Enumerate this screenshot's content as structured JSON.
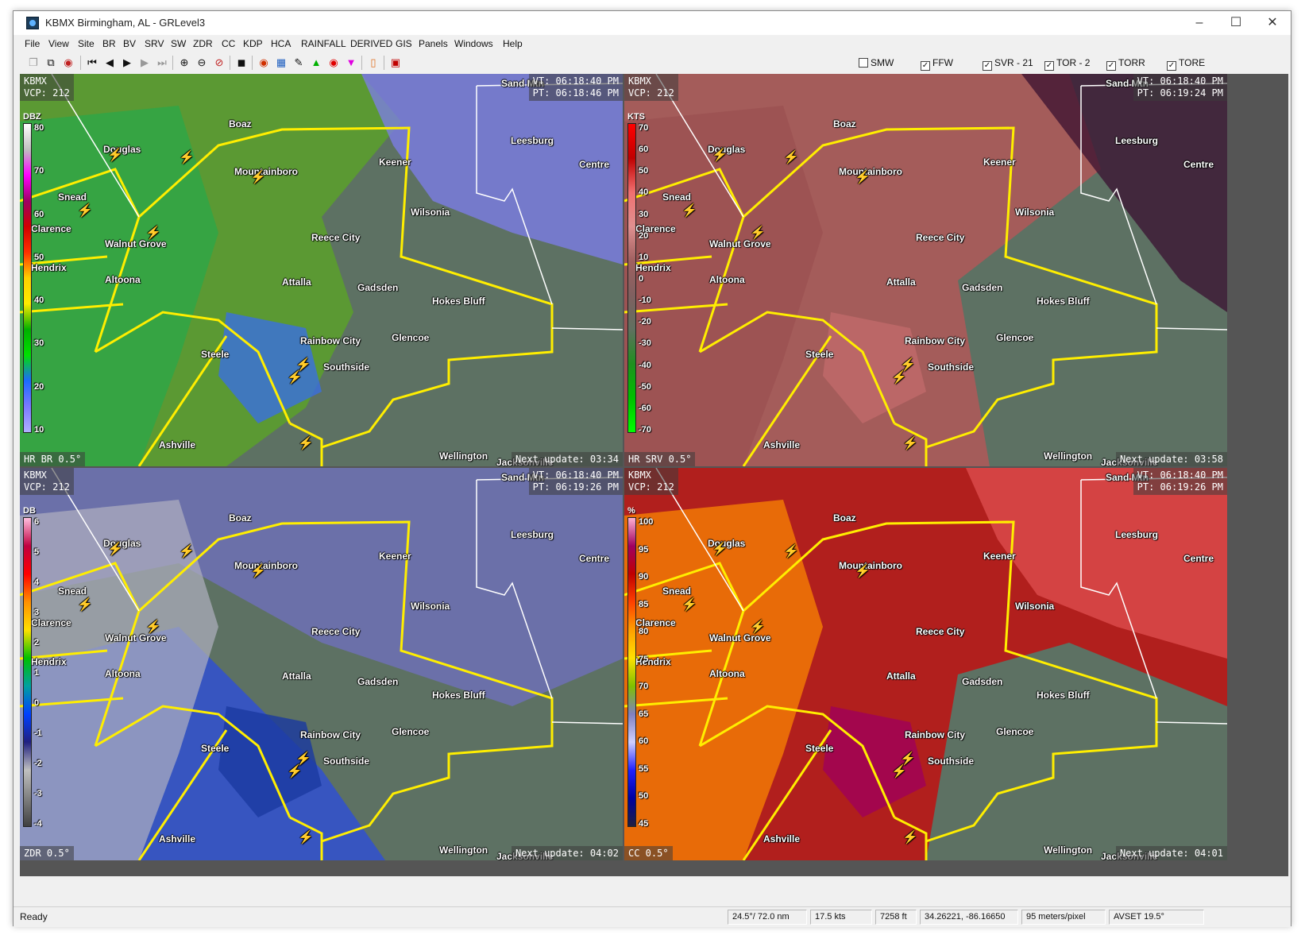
{
  "window": {
    "title": "KBMX Birmingham, AL - GRLevel3"
  },
  "menu": [
    "File",
    "View",
    "Site",
    "BR",
    "BV",
    "SRV",
    "SW",
    "ZDR",
    "CC",
    "KDP",
    "HCA",
    "RAINFALL",
    "DERIVED",
    "GIS",
    "Panels",
    "Windows",
    "Help"
  ],
  "warnings": [
    {
      "label": "SMW",
      "checked": false
    },
    {
      "label": "FFW",
      "checked": true
    },
    {
      "label": "SVR - 21",
      "checked": true
    },
    {
      "label": "TOR - 2",
      "checked": true
    },
    {
      "label": "TORR",
      "checked": true
    },
    {
      "label": "TORE",
      "checked": true
    }
  ],
  "cities": [
    "Sand Mtn",
    "Boaz",
    "Douglas",
    "Mountainboro",
    "Keener",
    "Leesburg",
    "Centre",
    "Snead",
    "Clarence",
    "Walnut Grove",
    "Wilsonia",
    "Reece City",
    "Altoona",
    "Attalla",
    "Gadsden",
    "Hokes Bluff",
    "Rainbow City",
    "Glencoe",
    "Steele",
    "Southside",
    "Ashville",
    "Wellington",
    "Jacksonville",
    "Hendrix"
  ],
  "panels": [
    {
      "site": "KBMX",
      "vcp": "VCP: 212",
      "vt": "VT: 06:18:40 PM",
      "pt": "PT: 06:18:46 PM",
      "product": "HR BR 0.5°",
      "next": "Next update: 03:34",
      "unit": "DBZ",
      "ticks": [
        "80",
        "70",
        "60",
        "50",
        "40",
        "30",
        "20",
        "10"
      ],
      "colors": [
        "#ffffff",
        "#c0c0c0",
        "#ff00ff",
        "#9c0064",
        "#d00000",
        "#ff3000",
        "#ffd000",
        "#ffea00",
        "#00b000",
        "#00e000",
        "#1c6bff",
        "#7a7aff",
        "#b0b0ff"
      ]
    },
    {
      "site": "KBMX",
      "vcp": "VCP: 212",
      "vt": "VT: 06:18:40 PM",
      "pt": "PT: 06:19:24 PM",
      "product": "HR SRV 0.5°",
      "next": "Next update: 03:58",
      "unit": "KTS",
      "ticks": [
        "70",
        "60",
        "50",
        "40",
        "30",
        "20",
        "10",
        "0",
        "-10",
        "-20",
        "-30",
        "-40",
        "-50",
        "-60",
        "-70"
      ],
      "colors": [
        "#ff0000",
        "#c00000",
        "#f07070",
        "#e09090",
        "#a06060",
        "#806060",
        "#607060",
        "#209020",
        "#00c000",
        "#00ff00"
      ]
    },
    {
      "site": "KBMX",
      "vcp": "VCP: 212",
      "vt": "VT: 06:18:40 PM",
      "pt": "PT: 06:19:26 PM",
      "product": "ZDR 0.5°",
      "next": "Next update: 04:02",
      "unit": "DB",
      "ticks": [
        "6",
        "5",
        "4",
        "3",
        "2",
        "1",
        "0",
        "-1",
        "-2",
        "-3",
        "-4"
      ],
      "colors": [
        "#ffc0e0",
        "#c00040",
        "#ff0000",
        "#ff9000",
        "#ffe000",
        "#00c000",
        "#00a0a0",
        "#0040ff",
        "#202080",
        "#c0c0c0",
        "#808080",
        "#404040"
      ]
    },
    {
      "site": "KBMX",
      "vcp": "VCP: 212",
      "vt": "VT: 06:18:40 PM",
      "pt": "PT: 06:19:26 PM",
      "product": "CC 0.5°",
      "next": "Next update: 04:01",
      "unit": "%",
      "ticks": [
        "100",
        "95",
        "90",
        "85",
        "80",
        "75",
        "70",
        "65",
        "60",
        "55",
        "50",
        "45"
      ],
      "colors": [
        "#ffb0d0",
        "#a00060",
        "#c00000",
        "#ff4000",
        "#ffa000",
        "#ffe000",
        "#80c000",
        "#8080c0",
        "#d0d0ff",
        "#2020ff",
        "#0000a0",
        "#202040"
      ]
    }
  ],
  "status": {
    "ready": "Ready",
    "azimuth": "24.5°/ 72.0 nm",
    "speed": "17.5 kts",
    "height": "7258 ft",
    "coords": "34.26221, -86.16650",
    "resolution": "95 meters/pixel",
    "avset": "AVSET 19.5°"
  }
}
